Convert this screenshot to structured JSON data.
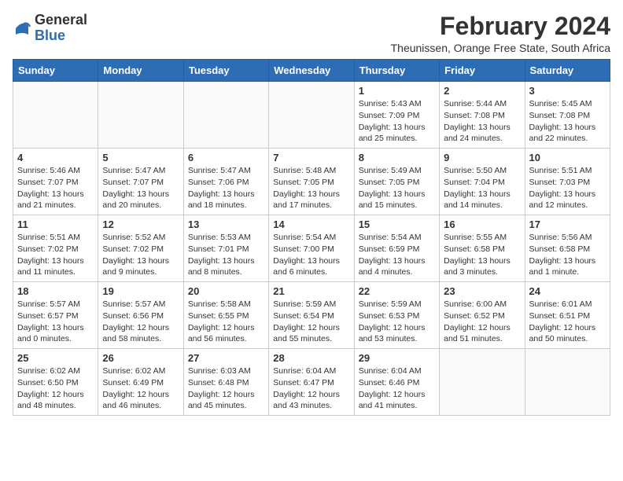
{
  "logo": {
    "text_general": "General",
    "text_blue": "Blue"
  },
  "title": "February 2024",
  "subtitle": "Theunissen, Orange Free State, South Africa",
  "days_of_week": [
    "Sunday",
    "Monday",
    "Tuesday",
    "Wednesday",
    "Thursday",
    "Friday",
    "Saturday"
  ],
  "weeks": [
    [
      {
        "day": "",
        "info": ""
      },
      {
        "day": "",
        "info": ""
      },
      {
        "day": "",
        "info": ""
      },
      {
        "day": "",
        "info": ""
      },
      {
        "day": "1",
        "info": "Sunrise: 5:43 AM\nSunset: 7:09 PM\nDaylight: 13 hours and 25 minutes."
      },
      {
        "day": "2",
        "info": "Sunrise: 5:44 AM\nSunset: 7:08 PM\nDaylight: 13 hours and 24 minutes."
      },
      {
        "day": "3",
        "info": "Sunrise: 5:45 AM\nSunset: 7:08 PM\nDaylight: 13 hours and 22 minutes."
      }
    ],
    [
      {
        "day": "4",
        "info": "Sunrise: 5:46 AM\nSunset: 7:07 PM\nDaylight: 13 hours and 21 minutes."
      },
      {
        "day": "5",
        "info": "Sunrise: 5:47 AM\nSunset: 7:07 PM\nDaylight: 13 hours and 20 minutes."
      },
      {
        "day": "6",
        "info": "Sunrise: 5:47 AM\nSunset: 7:06 PM\nDaylight: 13 hours and 18 minutes."
      },
      {
        "day": "7",
        "info": "Sunrise: 5:48 AM\nSunset: 7:05 PM\nDaylight: 13 hours and 17 minutes."
      },
      {
        "day": "8",
        "info": "Sunrise: 5:49 AM\nSunset: 7:05 PM\nDaylight: 13 hours and 15 minutes."
      },
      {
        "day": "9",
        "info": "Sunrise: 5:50 AM\nSunset: 7:04 PM\nDaylight: 13 hours and 14 minutes."
      },
      {
        "day": "10",
        "info": "Sunrise: 5:51 AM\nSunset: 7:03 PM\nDaylight: 13 hours and 12 minutes."
      }
    ],
    [
      {
        "day": "11",
        "info": "Sunrise: 5:51 AM\nSunset: 7:02 PM\nDaylight: 13 hours and 11 minutes."
      },
      {
        "day": "12",
        "info": "Sunrise: 5:52 AM\nSunset: 7:02 PM\nDaylight: 13 hours and 9 minutes."
      },
      {
        "day": "13",
        "info": "Sunrise: 5:53 AM\nSunset: 7:01 PM\nDaylight: 13 hours and 8 minutes."
      },
      {
        "day": "14",
        "info": "Sunrise: 5:54 AM\nSunset: 7:00 PM\nDaylight: 13 hours and 6 minutes."
      },
      {
        "day": "15",
        "info": "Sunrise: 5:54 AM\nSunset: 6:59 PM\nDaylight: 13 hours and 4 minutes."
      },
      {
        "day": "16",
        "info": "Sunrise: 5:55 AM\nSunset: 6:58 PM\nDaylight: 13 hours and 3 minutes."
      },
      {
        "day": "17",
        "info": "Sunrise: 5:56 AM\nSunset: 6:58 PM\nDaylight: 13 hours and 1 minute."
      }
    ],
    [
      {
        "day": "18",
        "info": "Sunrise: 5:57 AM\nSunset: 6:57 PM\nDaylight: 13 hours and 0 minutes."
      },
      {
        "day": "19",
        "info": "Sunrise: 5:57 AM\nSunset: 6:56 PM\nDaylight: 12 hours and 58 minutes."
      },
      {
        "day": "20",
        "info": "Sunrise: 5:58 AM\nSunset: 6:55 PM\nDaylight: 12 hours and 56 minutes."
      },
      {
        "day": "21",
        "info": "Sunrise: 5:59 AM\nSunset: 6:54 PM\nDaylight: 12 hours and 55 minutes."
      },
      {
        "day": "22",
        "info": "Sunrise: 5:59 AM\nSunset: 6:53 PM\nDaylight: 12 hours and 53 minutes."
      },
      {
        "day": "23",
        "info": "Sunrise: 6:00 AM\nSunset: 6:52 PM\nDaylight: 12 hours and 51 minutes."
      },
      {
        "day": "24",
        "info": "Sunrise: 6:01 AM\nSunset: 6:51 PM\nDaylight: 12 hours and 50 minutes."
      }
    ],
    [
      {
        "day": "25",
        "info": "Sunrise: 6:02 AM\nSunset: 6:50 PM\nDaylight: 12 hours and 48 minutes."
      },
      {
        "day": "26",
        "info": "Sunrise: 6:02 AM\nSunset: 6:49 PM\nDaylight: 12 hours and 46 minutes."
      },
      {
        "day": "27",
        "info": "Sunrise: 6:03 AM\nSunset: 6:48 PM\nDaylight: 12 hours and 45 minutes."
      },
      {
        "day": "28",
        "info": "Sunrise: 6:04 AM\nSunset: 6:47 PM\nDaylight: 12 hours and 43 minutes."
      },
      {
        "day": "29",
        "info": "Sunrise: 6:04 AM\nSunset: 6:46 PM\nDaylight: 12 hours and 41 minutes."
      },
      {
        "day": "",
        "info": ""
      },
      {
        "day": "",
        "info": ""
      }
    ]
  ]
}
